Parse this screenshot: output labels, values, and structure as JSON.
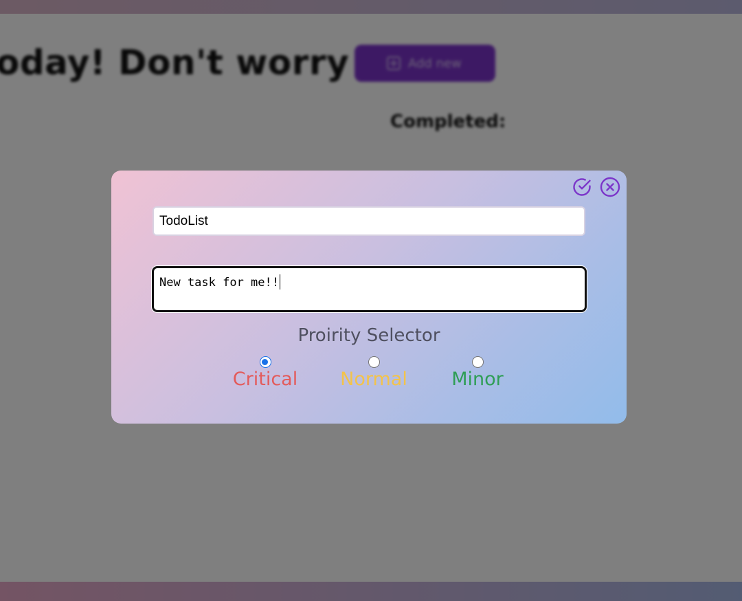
{
  "background": {
    "heading": "oday! Don't worry",
    "add_button_label": "Add new",
    "completed_label": "Completed:"
  },
  "modal": {
    "title_value": "TodoList",
    "description_value": "New task for me!!",
    "priority_title": "Proirity Selector",
    "priorities": [
      {
        "label": "Critical",
        "color": "#e35b5b",
        "checked": true
      },
      {
        "label": "Normal",
        "color": "#f3c34a",
        "checked": false
      },
      {
        "label": "Minor",
        "color": "#2f9e56",
        "checked": false
      }
    ],
    "icons": {
      "confirm": "check-circle-icon",
      "close": "close-circle-icon"
    },
    "accent_color": "#7b35c9"
  }
}
